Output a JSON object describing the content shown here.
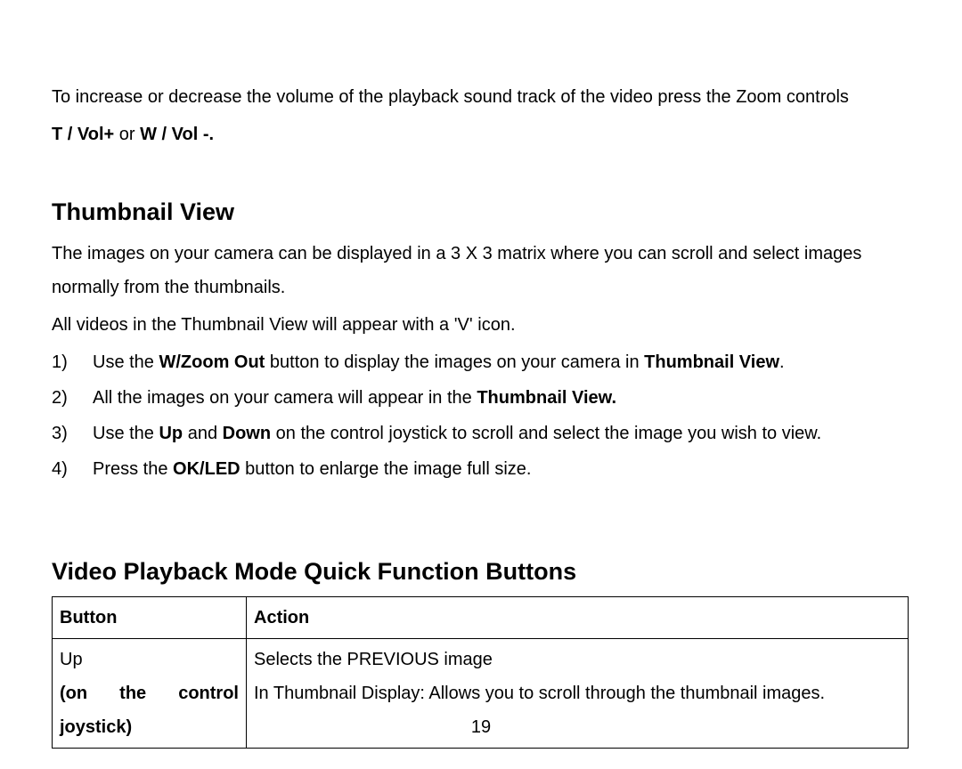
{
  "intro": {
    "line1": "To increase or decrease the volume of the playback sound track of the video press the Zoom controls",
    "vol_bold1": "T / Vol+ ",
    "vol_or": "or ",
    "vol_bold2": "W / Vol -."
  },
  "thumbnail": {
    "heading": "Thumbnail View",
    "p1": "The images on your camera can be displayed in a 3 X 3 matrix where you can scroll and select images normally from the thumbnails.",
    "p2": "All videos in the Thumbnail View will appear with a 'V' icon.",
    "items": [
      {
        "num": "1)",
        "pre": "Use the ",
        "b1": "W/Zoom Out",
        "mid": " button to display the images on your camera in ",
        "b2": "Thumbnail View",
        "post": "."
      },
      {
        "num": "2)",
        "pre": "All the images on your camera will appear in the ",
        "b1": "Thumbnail View.",
        "mid": "",
        "b2": "",
        "post": ""
      },
      {
        "num": "3)",
        "pre": "Use the ",
        "b1": "Up",
        "mid": " and ",
        "b2": "Down",
        "post": " on the control joystick to scroll and select the image you wish to view."
      },
      {
        "num": "4)",
        "pre": "Press the ",
        "b1": "OK/LED",
        "mid": " button to enlarge the image full size.",
        "b2": "",
        "post": ""
      }
    ]
  },
  "playback": {
    "heading": "Video Playback Mode Quick Function Buttons",
    "header_button": "Button",
    "header_action": "Action",
    "row1_button_line1": "Up",
    "row1_button_on": "(on",
    "row1_button_the": "the",
    "row1_button_control": "control",
    "row1_button_line3": "joystick)",
    "row1_action": "Selects the PREVIOUS image",
    "row1_action2": "In Thumbnail Display: Allows you to scroll through the thumbnail images."
  },
  "page_number": "19"
}
